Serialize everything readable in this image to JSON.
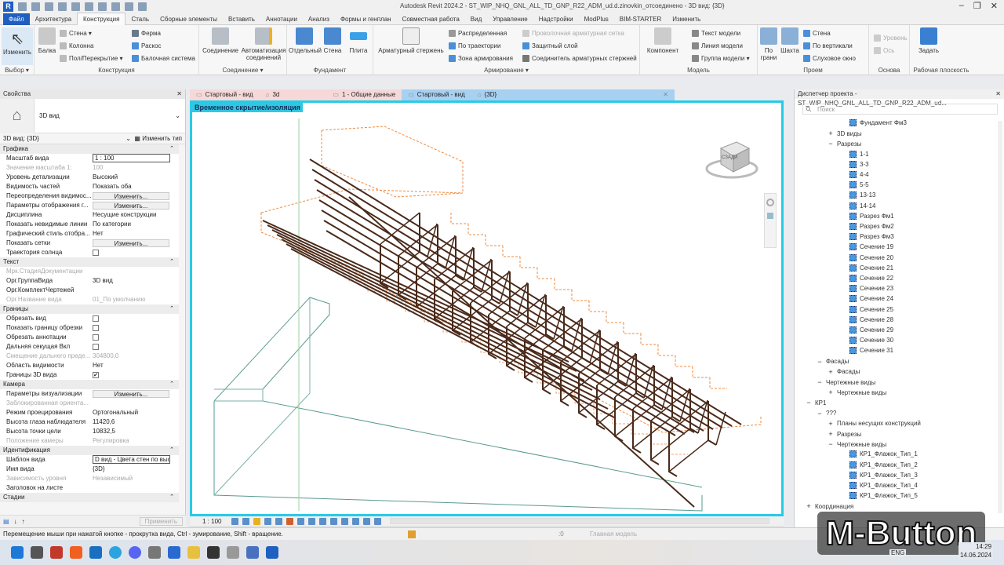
{
  "app": {
    "title": "Autodesk Revit 2024.2 - ST_WIP_NHQ_GNL_ALL_TD_GNP_R22_ADM_ud.d.zinovkin_отсоединено - 3D вид: {3D}"
  },
  "menu": [
    "Файл",
    "Архитектура",
    "Конструкция",
    "Сталь",
    "Сборные элементы",
    "Вставить",
    "Аннотации",
    "Анализ",
    "Формы и генплан",
    "Совместная работа",
    "Вид",
    "Управление",
    "Надстройки",
    "ModPlus",
    "BIM-STARTER",
    "Изменить"
  ],
  "menu_active": "Конструкция",
  "ribbon": {
    "select": {
      "modify": "Изменить",
      "group": "Выбор ▾"
    },
    "structure": {
      "beam": "Балка",
      "wall": "Стена ▾",
      "column": "Колонна",
      "floor": "Пол/Перекрытие ▾",
      "truss": "Ферма",
      "brace": "Раскос",
      "beam_system": "Балочная система",
      "group": "Конструкция"
    },
    "connection": {
      "conn": "Соединение",
      "auto": "Автоматизация соединений",
      "group": "Соединение ▾"
    },
    "foundation": {
      "isolated": "Отдельный",
      "wall": "Стена",
      "slab": "Плита",
      "group": "Фундамент"
    },
    "rebar": {
      "bar": "Арматурный стержень",
      "area": "Распределенная",
      "path": "По траектории",
      "fabric_area": "Зона армирования",
      "fabric_sheet": "Проволочная арматурная сетка",
      "cover": "Защитный слой",
      "coupler": "Соединитель арматурных стержней",
      "group": "Армирование ▾"
    },
    "model": {
      "component": "Компонент",
      "text": "Текст модели",
      "line": "Линия модели",
      "group_model": "Группа модели ▾",
      "group": "Модель"
    },
    "opening": {
      "by_face": "По грани",
      "shaft": "Шахта",
      "wall": "Стена",
      "vertical": "По вертикали",
      "dormer": "Слуховое окно",
      "group": "Проем"
    },
    "datum": {
      "level": "Уровень",
      "grid": "Ось",
      "group": "Основа"
    },
    "workplane": {
      "set": "Задать",
      "group": "Рабочая плоскость"
    }
  },
  "properties": {
    "title": "Свойства",
    "type_name": "3D вид",
    "selector": "3D вид: {3D}",
    "edit_type": "Изменить тип",
    "categories": [
      {
        "name": "Графика",
        "rows": [
          {
            "k": "Масштаб вида",
            "v": "1 : 100",
            "kind": "input"
          },
          {
            "k": "Значение масштаба   1:",
            "v": "100",
            "kind": "gray"
          },
          {
            "k": "Уровень детализации",
            "v": "Высокий"
          },
          {
            "k": "Видимость частей",
            "v": "Показать оба"
          },
          {
            "k": "Переопределения видимос...",
            "v": "Изменить...",
            "kind": "button"
          },
          {
            "k": "Параметры отображения г...",
            "v": "Изменить...",
            "kind": "button"
          },
          {
            "k": "Дисциплина",
            "v": "Несущие конструкции"
          },
          {
            "k": "Показать невидимые линии",
            "v": "По категории"
          },
          {
            "k": "Графический стиль отобра...",
            "v": "Нет"
          },
          {
            "k": "Показать сетки",
            "v": "Изменить...",
            "kind": "button"
          },
          {
            "k": "Траектория солнца",
            "v": "",
            "kind": "check"
          }
        ]
      },
      {
        "name": "Текст",
        "rows": [
          {
            "k": "Мрк.СтадияДокументации",
            "v": "",
            "kind": "gray"
          },
          {
            "k": "Орг.ГруппаВида",
            "v": "3D вид"
          },
          {
            "k": "Орг.КомплектЧертежей",
            "v": ""
          },
          {
            "k": "Орг.Название вида",
            "v": "01_По умолчанию",
            "kind": "gray"
          }
        ]
      },
      {
        "name": "Границы",
        "rows": [
          {
            "k": "Обрезать вид",
            "v": "",
            "kind": "check"
          },
          {
            "k": "Показать границу обрезки",
            "v": "",
            "kind": "check"
          },
          {
            "k": "Обрезать аннотации",
            "v": "",
            "kind": "check"
          },
          {
            "k": "Дальняя секущая Вкл",
            "v": "",
            "kind": "check"
          },
          {
            "k": "Смещение дальнего преде...",
            "v": "304800,0",
            "kind": "gray"
          },
          {
            "k": "Область видимости",
            "v": "Нет"
          },
          {
            "k": "Границы 3D вида",
            "v": "✔",
            "kind": "checked"
          }
        ]
      },
      {
        "name": "Камера",
        "rows": [
          {
            "k": "Параметры визуализации",
            "v": "Изменить...",
            "kind": "button"
          },
          {
            "k": "Заблокированная ориента...",
            "v": "",
            "kind": "gray"
          },
          {
            "k": "Режим проецирования",
            "v": "Ортогональный"
          },
          {
            "k": "Высота глаза наблюдателя",
            "v": "11420,6"
          },
          {
            "k": "Высота точки цели",
            "v": "10832,5"
          },
          {
            "k": "Положение камеры",
            "v": "Регулировка",
            "kind": "gray"
          }
        ]
      },
      {
        "name": "Идентификация",
        "rows": [
          {
            "k": "Шаблон вида",
            "v": "D вид - Цвета стен по высоте",
            "kind": "input"
          },
          {
            "k": "Имя вида",
            "v": "{3D}"
          },
          {
            "k": "Зависимость уровня",
            "v": "Независимый",
            "kind": "gray"
          },
          {
            "k": "Заголовок на листе",
            "v": ""
          }
        ]
      },
      {
        "name": "Стадии",
        "rows": []
      }
    ],
    "apply": "Применить"
  },
  "view_tabs": [
    {
      "label": "Стартовый - вид",
      "icon": "sheet"
    },
    {
      "label": "3d",
      "icon": "house"
    },
    {
      "label": "1 - Общие данные",
      "icon": "sheet"
    },
    {
      "label": "Стартовый - вид",
      "icon": "sheet",
      "active": true
    },
    {
      "label": "{3D}",
      "icon": "house",
      "active": true
    }
  ],
  "viewport": {
    "isolation_label": "Временное скрытие/изоляция",
    "viewcube_label": "СЗАДИ"
  },
  "view_control": {
    "scale": "1 : 100"
  },
  "status": {
    "hint": "Перемещение мыши при нажатой кнопке - прокрутка вида, Ctrl - зумирование, Shift - вращение.",
    "workset_count": ":0",
    "main_model": "Главная модель"
  },
  "browser": {
    "title": "Диспетчер проекта - ST_WIP_NHQ_GNL_ALL_TD_GNP_R22_ADM_ud...",
    "search_placeholder": "Поиск",
    "items": [
      {
        "t": "Фундамент Фм3",
        "lvl": 3,
        "type": "view"
      },
      {
        "t": "3D виды",
        "lvl": 1,
        "type": "plus"
      },
      {
        "t": "Разрезы",
        "lvl": 1,
        "type": "minus"
      },
      {
        "t": "1-1",
        "lvl": 3,
        "type": "view"
      },
      {
        "t": "3-3",
        "lvl": 3,
        "type": "view"
      },
      {
        "t": "4-4",
        "lvl": 3,
        "type": "view"
      },
      {
        "t": "5-5",
        "lvl": 3,
        "type": "view"
      },
      {
        "t": "13-13",
        "lvl": 3,
        "type": "view"
      },
      {
        "t": "14-14",
        "lvl": 3,
        "type": "view"
      },
      {
        "t": "Разрез Фм1",
        "lvl": 3,
        "type": "view"
      },
      {
        "t": "Разрез Фм2",
        "lvl": 3,
        "type": "view"
      },
      {
        "t": "Разрез Фм3",
        "lvl": 3,
        "type": "view"
      },
      {
        "t": "Сечение 19",
        "lvl": 3,
        "type": "view"
      },
      {
        "t": "Сечение 20",
        "lvl": 3,
        "type": "view"
      },
      {
        "t": "Сечение 21",
        "lvl": 3,
        "type": "view"
      },
      {
        "t": "Сечение 22",
        "lvl": 3,
        "type": "view"
      },
      {
        "t": "Сечение 23",
        "lvl": 3,
        "type": "view"
      },
      {
        "t": "Сечение 24",
        "lvl": 3,
        "type": "view"
      },
      {
        "t": "Сечение 25",
        "lvl": 3,
        "type": "view"
      },
      {
        "t": "Сечение 28",
        "lvl": 3,
        "type": "view"
      },
      {
        "t": "Сечение 29",
        "lvl": 3,
        "type": "view"
      },
      {
        "t": "Сечение 30",
        "lvl": 3,
        "type": "view"
      },
      {
        "t": "Сечение 31",
        "lvl": 3,
        "type": "view"
      },
      {
        "t": "Фасады",
        "lvl": 0,
        "type": "minus"
      },
      {
        "t": "Фасады",
        "lvl": 1,
        "type": "plus"
      },
      {
        "t": "Чертежные виды",
        "lvl": 0,
        "type": "minus"
      },
      {
        "t": "Чертежные виды",
        "lvl": 1,
        "type": "plus"
      },
      {
        "t": "КР1",
        "lvl": -1,
        "type": "minus"
      },
      {
        "t": "???",
        "lvl": 0,
        "type": "minus"
      },
      {
        "t": "Планы несущих конструкций",
        "lvl": 1,
        "type": "plus"
      },
      {
        "t": "Разрезы",
        "lvl": 1,
        "type": "plus"
      },
      {
        "t": "Чертежные виды",
        "lvl": 1,
        "type": "minus"
      },
      {
        "t": "КР1_Флажок_Тип_1",
        "lvl": 3,
        "type": "view"
      },
      {
        "t": "КР1_Флажок_Тип_2",
        "lvl": 3,
        "type": "view"
      },
      {
        "t": "КР1_Флажок_Тип_3",
        "lvl": 3,
        "type": "view"
      },
      {
        "t": "КР1_Флажок_Тип_4",
        "lvl": 3,
        "type": "view"
      },
      {
        "t": "КР1_Флажок_Тип_5",
        "lvl": 3,
        "type": "view"
      },
      {
        "t": "Координация",
        "lvl": -1,
        "type": "plus"
      }
    ]
  },
  "taskbar": {
    "lang": "ENG",
    "time": "14:29",
    "date": "14.06.2024"
  },
  "watermark": "M-Button",
  "colors": {
    "accent": "#1f5fbf",
    "viewport_border": "#27cbe6",
    "rebar": "#4a2a1a",
    "concrete_edge": "#f08a3c",
    "outline": "#2a8a7a"
  }
}
